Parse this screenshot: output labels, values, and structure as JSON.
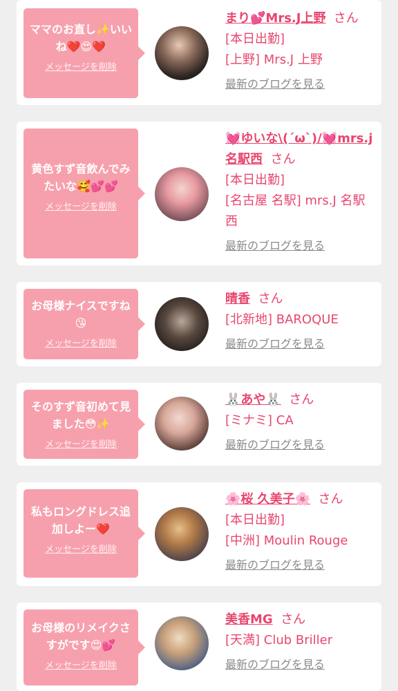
{
  "items": [
    {
      "bubble_message": "ママのお直し✨いいね❤️😍❤️",
      "delete_label": "メッセージを削除",
      "name": "まり💕Mrs.J上野",
      "honorific": "さん",
      "lines": [
        "[本日出勤]",
        "[上野] Mrs.J 上野"
      ],
      "blog_link": "最新のブログを見る"
    },
    {
      "bubble_message": "黄色すず音飲んでみたいな🥰💕💕",
      "delete_label": "メッセージを削除",
      "name": "💓ゆいな\\(´ω`)/💓mrs.j名駅西",
      "honorific": "さん",
      "lines": [
        "[本日出勤]",
        "[名古屋 名駅] mrs.J 名駅西"
      ],
      "blog_link": "最新のブログを見る"
    },
    {
      "bubble_message": "お母様ナイスですね😘",
      "delete_label": "メッセージを削除",
      "name": "晴香",
      "honorific": "さん",
      "lines": [
        "[北新地] BAROQUE"
      ],
      "blog_link": "最新のブログを見る"
    },
    {
      "bubble_message": "そのすず音初めて見ました😳✨",
      "delete_label": "メッセージを削除",
      "name": "🐰あや🐰",
      "honorific": "さん",
      "lines": [
        "[ミナミ] CA"
      ],
      "blog_link": "最新のブログを見る"
    },
    {
      "bubble_message": "私もロングドレス追加しよー❤️",
      "delete_label": "メッセージを削除",
      "name": "🌸桜 久美子🌸",
      "honorific": "さん",
      "lines": [
        "[本日出勤]",
        "[中洲] Moulin Rouge"
      ],
      "blog_link": "最新のブログを見る"
    },
    {
      "bubble_message": "お母様のリメイクさすがです😍💕",
      "delete_label": "メッセージを削除",
      "name": "美香MG",
      "honorific": "さん",
      "lines": [
        "[天満] Club Briller"
      ],
      "blog_link": "最新のブログを見る"
    }
  ],
  "colors": {
    "bubble": "#f7a0ad",
    "name": "#e8466e",
    "link": "#8a8a8a",
    "background": "#efefef"
  }
}
